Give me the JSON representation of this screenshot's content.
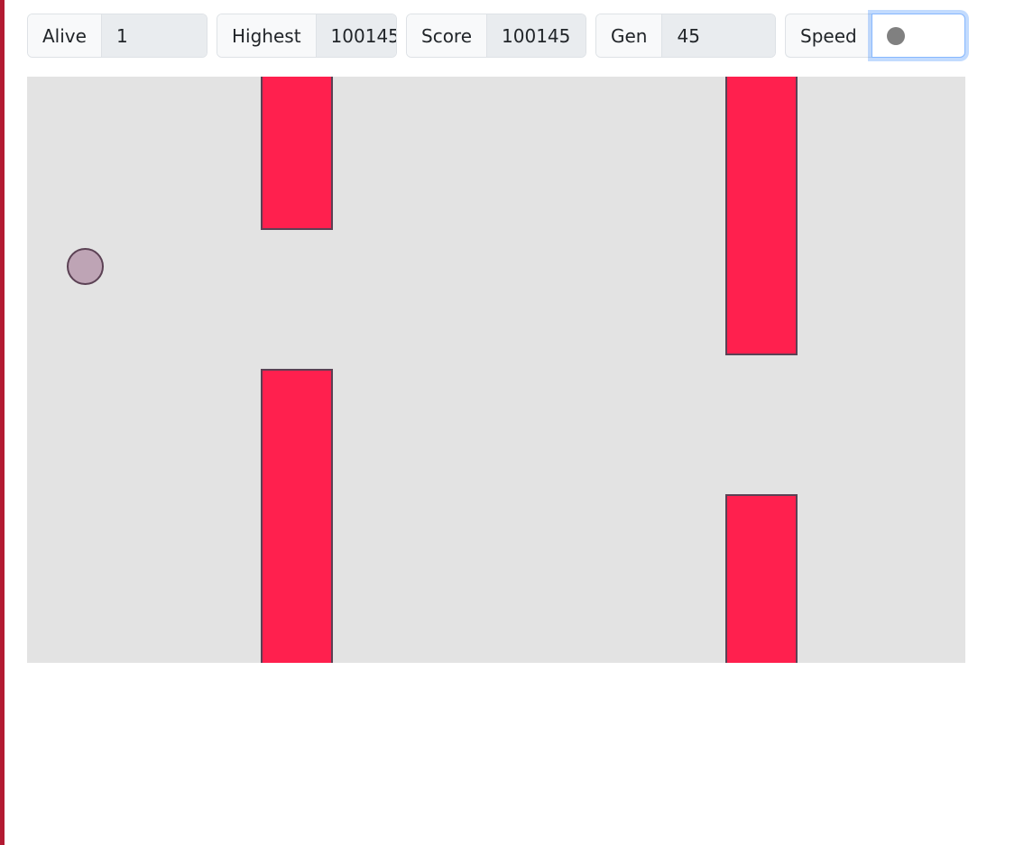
{
  "stats": {
    "alive": {
      "label": "Alive",
      "value": "1"
    },
    "highest": {
      "label": "Highest",
      "value": "100145"
    },
    "score": {
      "label": "Score",
      "value": "100145"
    },
    "gen": {
      "label": "Gen",
      "value": "45"
    },
    "speed": {
      "label": "Speed"
    }
  },
  "colors": {
    "accent_bar": "#b31a32",
    "pipe": "#ff204e",
    "pipe_border": "#5b4154",
    "bird": "#bea4b5",
    "game_bg": "#e3e3e3"
  }
}
